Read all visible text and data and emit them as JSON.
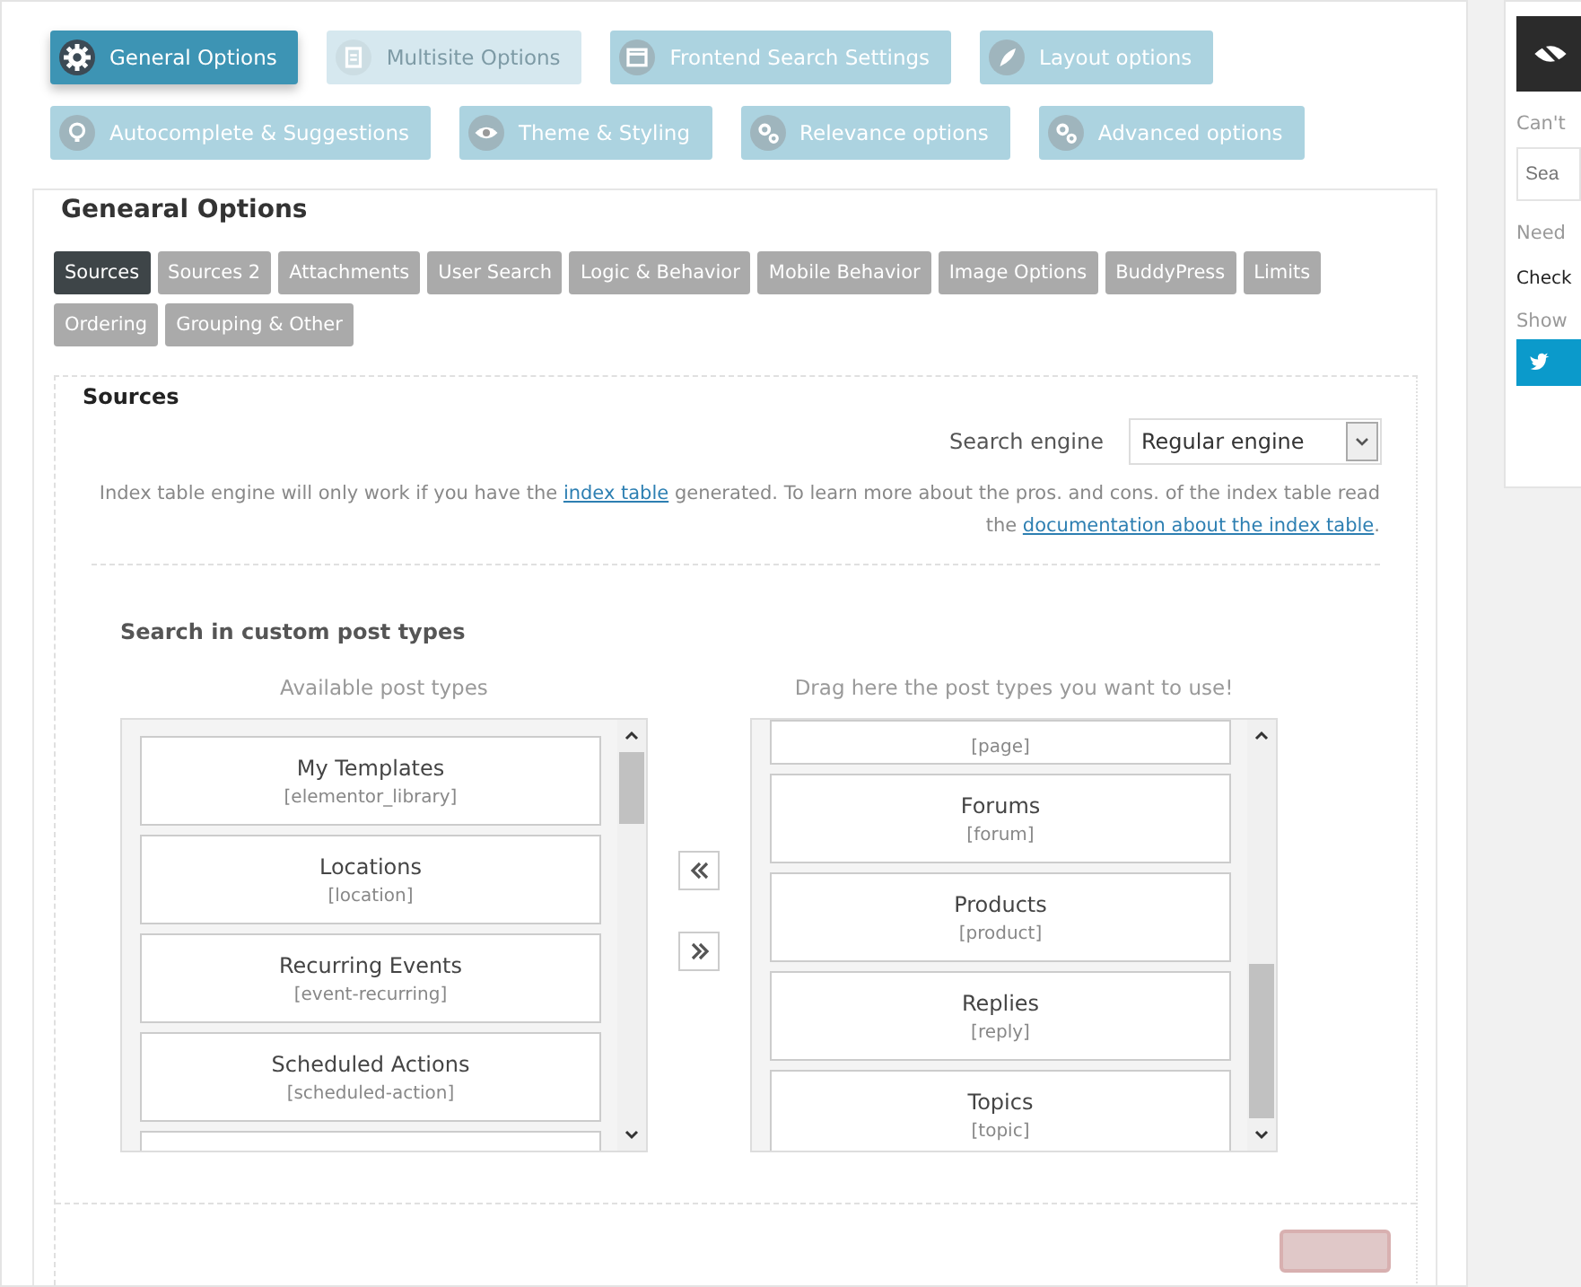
{
  "main_tabs": [
    {
      "label": "General Options",
      "selected": true,
      "disabled": false
    },
    {
      "label": "Multisite Options",
      "selected": false,
      "disabled": true
    },
    {
      "label": "Frontend Search Settings",
      "selected": false,
      "disabled": false
    },
    {
      "label": "Layout options",
      "selected": false,
      "disabled": false
    },
    {
      "label": "Autocomplete & Suggestions",
      "selected": false,
      "disabled": false
    },
    {
      "label": "Theme & Styling",
      "selected": false,
      "disabled": false
    },
    {
      "label": "Relevance options",
      "selected": false,
      "disabled": false
    },
    {
      "label": "Advanced options",
      "selected": false,
      "disabled": false
    }
  ],
  "section": {
    "title": "Genearal Options",
    "sub_tabs": [
      {
        "label": "Sources",
        "selected": true
      },
      {
        "label": "Sources 2",
        "selected": false
      },
      {
        "label": "Attachments",
        "selected": false
      },
      {
        "label": "User Search",
        "selected": false
      },
      {
        "label": "Logic & Behavior",
        "selected": false
      },
      {
        "label": "Mobile Behavior",
        "selected": false
      },
      {
        "label": "Image Options",
        "selected": false
      },
      {
        "label": "BuddyPress",
        "selected": false
      },
      {
        "label": "Limits",
        "selected": false
      },
      {
        "label": "Ordering",
        "selected": false
      },
      {
        "label": "Grouping & Other",
        "selected": false
      }
    ],
    "sources": {
      "title": "Sources",
      "engine_label": "Search engine",
      "engine_value": "Regular engine",
      "note_before": "Index table engine will only work if you have the",
      "note_link": "index table",
      "note_middle": "generated.  To learn more about the pros. and cons. of the index table read the",
      "note_link2": "documentation about the index table",
      "note_end": ".",
      "post_types": {
        "title": "Search in custom post types",
        "available_label": "Available post types",
        "selected_label": "Drag here the post types you want to use!",
        "available": [
          {
            "kind": "full",
            "name": "My Templates",
            "slug": "[elementor_library]"
          },
          {
            "kind": "full",
            "name": "Locations",
            "slug": "[location]"
          },
          {
            "kind": "full",
            "name": "Recurring Events",
            "slug": "[event-recurring]"
          },
          {
            "kind": "full",
            "name": "Scheduled Actions",
            "slug": "[scheduled-action]"
          },
          {
            "kind": "cut"
          }
        ],
        "chosen": [
          {
            "kind": "slug-only",
            "slug": "[page]"
          },
          {
            "kind": "full",
            "name": "Forums",
            "slug": "[forum]"
          },
          {
            "kind": "full",
            "name": "Products",
            "slug": "[product]"
          },
          {
            "kind": "full",
            "name": "Replies",
            "slug": "[reply]"
          },
          {
            "kind": "full",
            "name": "Topics",
            "slug": "[topic]"
          }
        ]
      },
      "toggle": {
        "on": false
      }
    }
  },
  "sidebar": {
    "heading_1": "Can't",
    "search_placeholder": "Sea",
    "heading_2": "Need",
    "link": "Check",
    "heading_3": "Show"
  }
}
